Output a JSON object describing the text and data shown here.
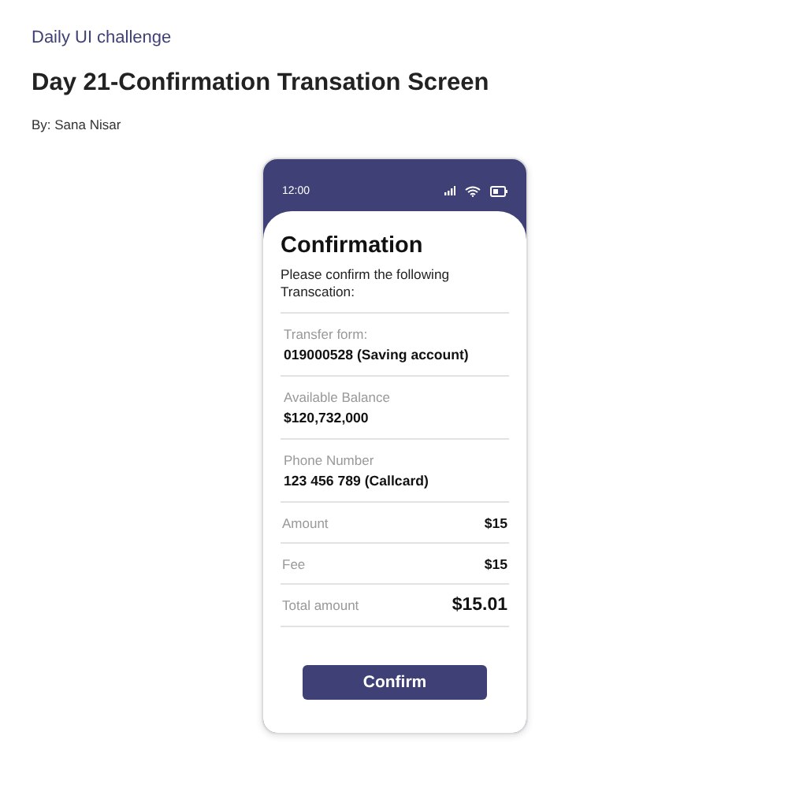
{
  "header": {
    "series": "Daily UI challenge",
    "title": "Day 21-Confirmation Transation Screen",
    "author": "By: Sana Nisar"
  },
  "phone": {
    "status_bar": {
      "time": "12:00"
    },
    "heading": "Confirmation",
    "intro": "Please confirm the following Transcation:",
    "details": [
      {
        "kind": "stacked",
        "label": "Transfer form:",
        "value": "019000528 (Saving account)"
      },
      {
        "kind": "stacked",
        "label": "Available Balance",
        "value": "$120,732,000"
      },
      {
        "kind": "stacked",
        "label": "Phone Number",
        "value": "123 456 789 (Callcard)"
      },
      {
        "kind": "inline",
        "label": "Amount",
        "value": "$15"
      },
      {
        "kind": "inline",
        "label": "Fee",
        "value": "$15"
      },
      {
        "kind": "total",
        "label": "Total amount",
        "value": "$15.01"
      }
    ],
    "button": "Confirm"
  }
}
